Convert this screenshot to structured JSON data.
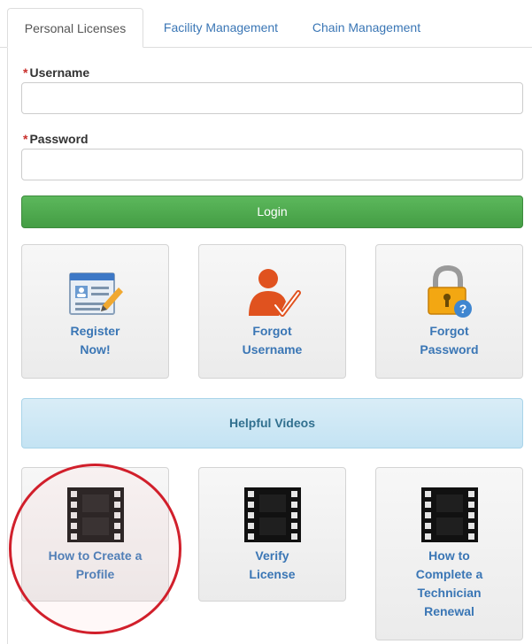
{
  "tabs": [
    "Personal Licenses",
    "Facility Management",
    "Chain Management"
  ],
  "form": {
    "required_mark": "*",
    "username_label": "Username",
    "username_value": "",
    "password_label": "Password",
    "password_value": "",
    "login_label": "Login"
  },
  "actions": {
    "register": [
      "Register",
      "Now!"
    ],
    "forgot_username": [
      "Forgot",
      "Username"
    ],
    "forgot_password": [
      "Forgot",
      "Password"
    ]
  },
  "helpful_videos_label": "Helpful Videos",
  "videos": {
    "create_profile": [
      "How to Create a",
      "Profile"
    ],
    "verify_license": [
      "Verify",
      "License"
    ],
    "technician_renewal": [
      "How to",
      "Complete a",
      "Technician",
      "Renewal"
    ]
  },
  "icons": {
    "register": "registration-form-icon",
    "forgot_username": "user-check-icon",
    "forgot_password": "padlock-question-icon",
    "video": "film-strip-icon"
  },
  "colors": {
    "link": "#3a76b5",
    "login": "#5cb85c",
    "required": "#c9302c",
    "info": "#d9edf7",
    "highlight": "#d11f2b"
  }
}
